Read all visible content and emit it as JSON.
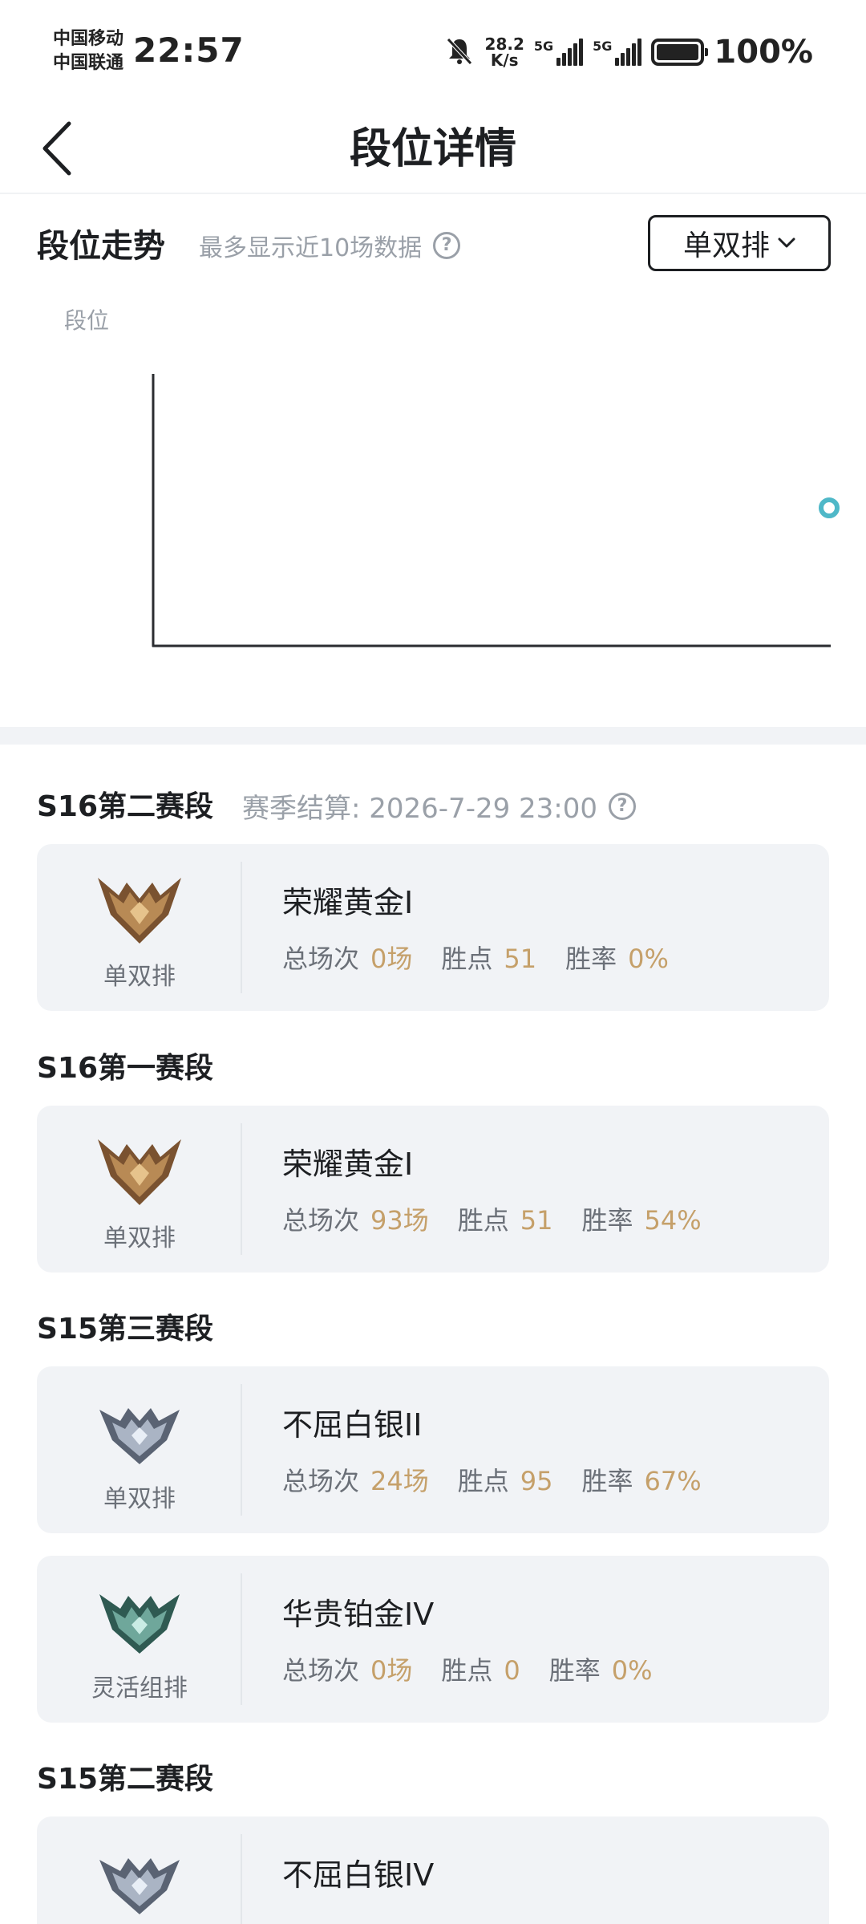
{
  "status_bar": {
    "carrier1": "中国移动",
    "carrier2": "中国联通",
    "time": "22:57",
    "net_speed_value": "28.2",
    "net_speed_unit": "K/s",
    "signal1_label": "5G",
    "signal2_label": "5G",
    "battery": "100%",
    "icons": [
      "mute-icon",
      "signal-icon",
      "signal-icon",
      "battery-icon"
    ]
  },
  "nav": {
    "title": "段位详情",
    "back_icon": "chevron-left-icon"
  },
  "trend": {
    "title": "段位走势",
    "hint": "最多显示近10场数据",
    "help_glyph": "?",
    "queue_selector": "单双排",
    "selector_icon": "chevron-down-icon",
    "y_title": "段位"
  },
  "chart_data": {
    "type": "line",
    "ylabel": "段位",
    "series": [
      {
        "points": 1
      }
    ],
    "accent": "#4fb8c8"
  },
  "seasons": [
    {
      "title": "S16第二赛段",
      "settle_text": "赛季结算: 2026-7-29 23:00",
      "cards": [
        {
          "queue": "单双排",
          "tier": "荣耀黄金I",
          "emblem": "gold-emblem-icon",
          "games_label": "总场次",
          "games": "0场",
          "points_label": "胜点",
          "points": "51",
          "winrate_label": "胜率",
          "winrate": "0%"
        }
      ]
    },
    {
      "title": "S16第一赛段",
      "cards": [
        {
          "queue": "单双排",
          "tier": "荣耀黄金I",
          "emblem": "gold-emblem-icon",
          "games_label": "总场次",
          "games": "93场",
          "points_label": "胜点",
          "points": "51",
          "winrate_label": "胜率",
          "winrate": "54%"
        }
      ]
    },
    {
      "title": "S15第三赛段",
      "cards": [
        {
          "queue": "单双排",
          "tier": "不屈白银II",
          "emblem": "silver-emblem-icon",
          "games_label": "总场次",
          "games": "24场",
          "points_label": "胜点",
          "points": "95",
          "winrate_label": "胜率",
          "winrate": "67%"
        },
        {
          "queue": "灵活组排",
          "tier": "华贵铂金IV",
          "emblem": "platinum-emblem-icon",
          "games_label": "总场次",
          "games": "0场",
          "points_label": "胜点",
          "points": "0",
          "winrate_label": "胜率",
          "winrate": "0%"
        }
      ]
    },
    {
      "title": "S15第二赛段",
      "cards": [
        {
          "tier": "不屈白银IV",
          "emblem": "silver-emblem-icon"
        }
      ]
    }
  ],
  "colors": {
    "stat_value": "#c5a06a",
    "muted_text": "#9aa0a8",
    "card_bg": "#f1f3f6",
    "chart_point": "#4fb8c8"
  }
}
